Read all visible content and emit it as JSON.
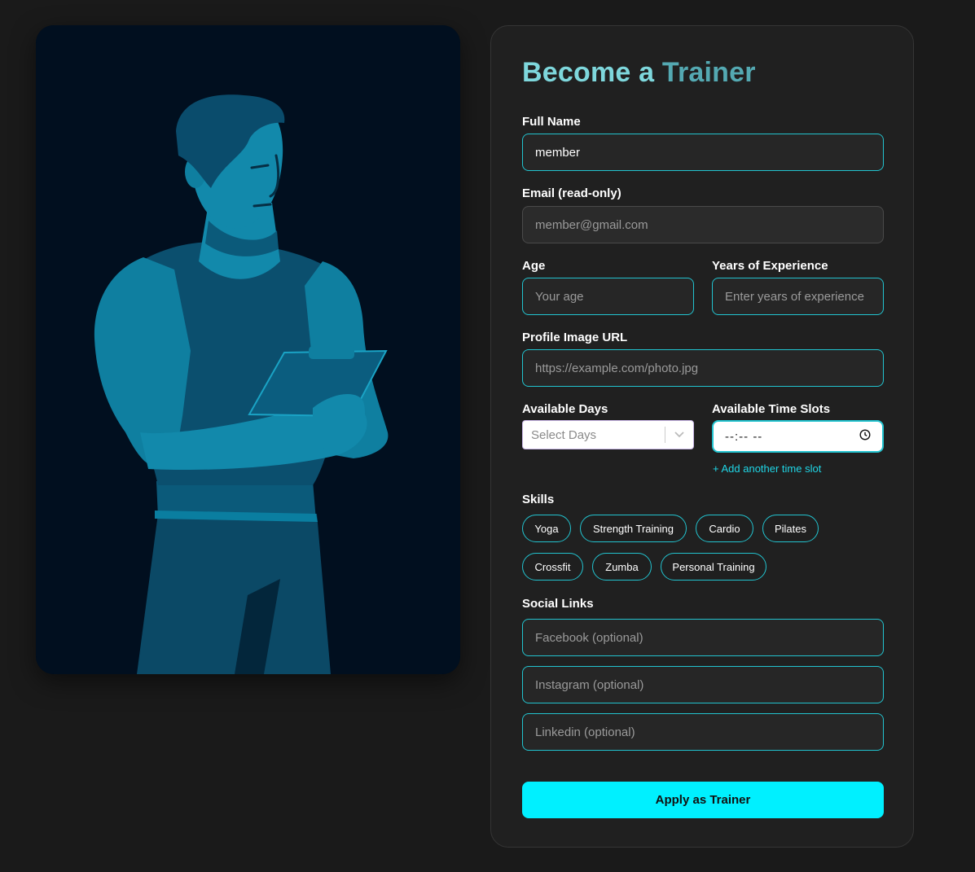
{
  "form": {
    "title_part1": "Become a ",
    "title_part2": "Trainer",
    "full_name_label": "Full Name",
    "full_name_value": "member",
    "email_label": "Email (read-only)",
    "email_value": "member@gmail.com",
    "age_label": "Age",
    "age_placeholder": "Your age",
    "experience_label": "Years of Experience",
    "experience_placeholder": "Enter years of experience",
    "profile_label": "Profile Image URL",
    "profile_placeholder": "https://example.com/photo.jpg",
    "days_label": "Available Days",
    "days_placeholder": "Select Days",
    "slots_label": "Available Time Slots",
    "slot_value": "--:-- --",
    "add_slot": "+ Add another time slot",
    "skills_label": "Skills",
    "skills": [
      "Yoga",
      "Strength Training",
      "Cardio",
      "Pilates",
      "Crossfit",
      "Zumba",
      "Personal Training"
    ],
    "social_label": "Social Links",
    "facebook_placeholder": "Facebook (optional)",
    "instagram_placeholder": "Instagram (optional)",
    "linkedin_placeholder": "Linkedin (optional)",
    "submit": "Apply as Trainer"
  },
  "colors": {
    "accent": "#00f0ff",
    "field_border": "#22c3cf",
    "title_light": "#7ed7dc",
    "title_dark": "#54a9b2",
    "background": "#1a1a1a",
    "card": "#202020",
    "hero_bg": "#010f1f"
  },
  "icons": {
    "hero": "trainer-illustration",
    "select": "chevron-down-icon",
    "time": "clock-icon"
  }
}
